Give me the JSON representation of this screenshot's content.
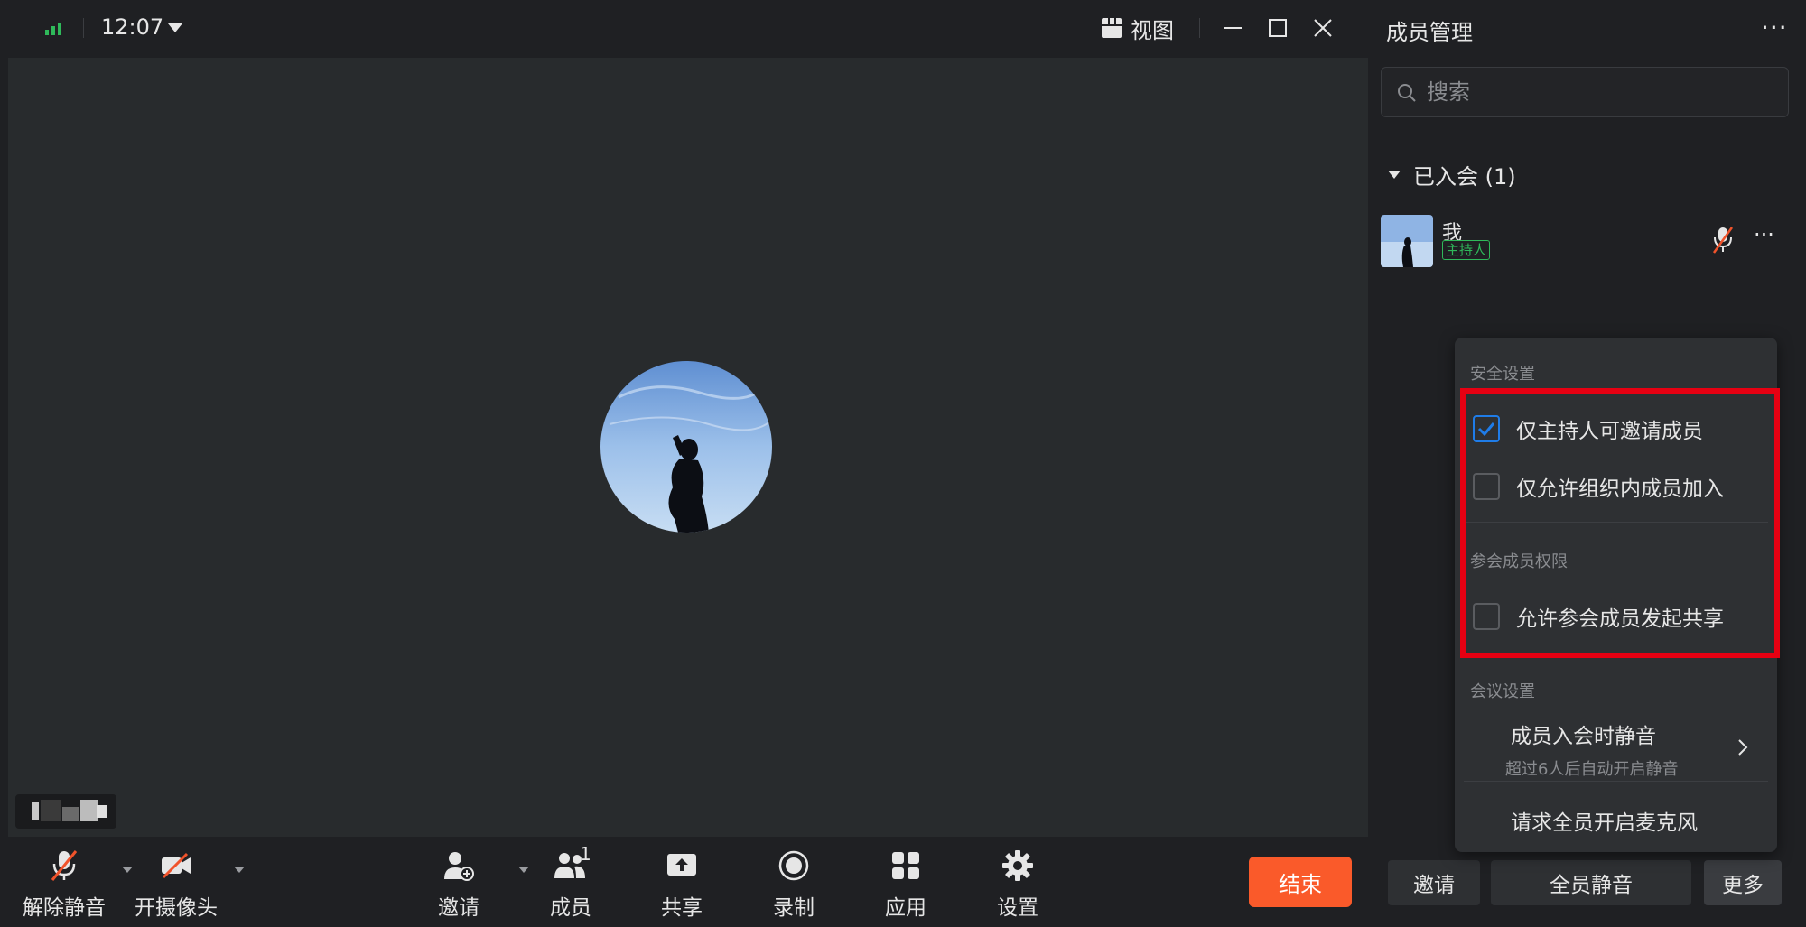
{
  "titlebar": {
    "time": "12:07",
    "view_label": "视图"
  },
  "toolbar": {
    "unmute": "解除静音",
    "camera": "开摄像头",
    "invite": "邀请",
    "members": "成员",
    "members_count": "1",
    "share": "共享",
    "record": "录制",
    "apps": "应用",
    "settings": "设置",
    "end": "结束"
  },
  "panel": {
    "title": "成员管理",
    "more": "···",
    "search_placeholder": "搜索",
    "joined_header": "已入会 (1)",
    "member": {
      "name": "我",
      "role": "主持人"
    }
  },
  "popup": {
    "security_header": "安全设置",
    "opt_host_invite": "仅主持人可邀请成员",
    "opt_org_only": "仅允许组织内成员加入",
    "permission_header": "参会成员权限",
    "opt_allow_share": "允许参会成员发起共享",
    "meeting_header": "会议设置",
    "mute_on_join": "成员入会时静音",
    "mute_on_join_sub": "超过6人后自动开启静音",
    "request_mic": "请求全员开启麦克风"
  },
  "panel_buttons": {
    "invite": "邀请",
    "mute_all": "全员静音",
    "more": "更多"
  },
  "colors": {
    "accent_blue": "#1f7ce8",
    "end_orange": "#fa5a2a",
    "highlight_red": "#e60012",
    "host_green": "#2fb95a"
  }
}
